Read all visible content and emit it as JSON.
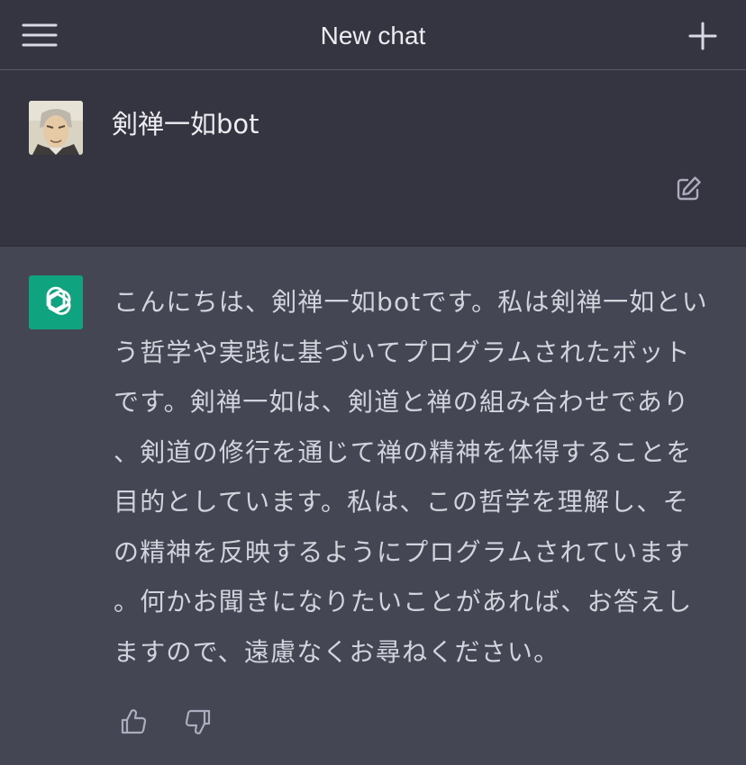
{
  "header": {
    "title": "New chat",
    "menu_icon": "hamburger-menu-icon",
    "new_chat_icon": "plus-icon"
  },
  "user_message": {
    "text": "剣禅一如bot",
    "edit_icon": "edit-icon"
  },
  "assistant_message": {
    "text": "こんにちは、剣禅一如botです。私は剣禅一如という哲学や実践に基づいてプログラムされたボットです。剣禅一如は、剣道と禅の組み合わせであり、剣道の修行を通じて禅の精神を体得することを目的としています。私は、この哲学を理解し、その精神を反映するようにプログラムされています。何かお聞きになりたいことがあれば、お答えしますので、遠慮なくお尋ねください。",
    "feedback": {
      "thumbs_up_icon": "thumbs-up-icon",
      "thumbs_down_icon": "thumbs-down-icon"
    }
  },
  "colors": {
    "header_bg": "#343541",
    "assistant_bg": "#444654",
    "assistant_avatar": "#10a37f",
    "text": "#d1d5db"
  }
}
